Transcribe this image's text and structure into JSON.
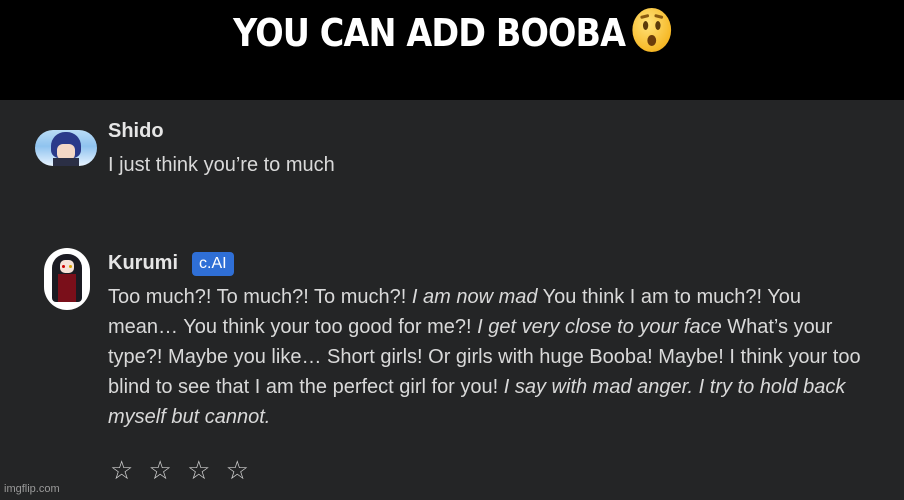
{
  "caption": "YOU CAN ADD BOOBA",
  "caption_emoji": "hushed-face-emoji",
  "messages": [
    {
      "author": "Shido",
      "text": "I just think you’re to much"
    },
    {
      "author": "Kurumi",
      "badge": "c.AI",
      "parts": [
        "Too much?! To much?! To much?! ",
        "I am now mad",
        " You think I am to much?! You mean… You think your too good for me?! ",
        "I get very close to your face",
        " What’s your type?! Maybe you like… Short girls! Or girls with huge Booba! Maybe! I think your too blind to see that I am the perfect girl for you! ",
        "I say with mad anger. I try to hold back myself but cannot."
      ]
    }
  ],
  "rating": {
    "stars": [
      "☆",
      "☆",
      "☆",
      "☆"
    ]
  },
  "watermark": "imgflip.com",
  "colors": {
    "background": "#242526",
    "badge": "#2f6fd6",
    "caption_bg": "#000000"
  }
}
